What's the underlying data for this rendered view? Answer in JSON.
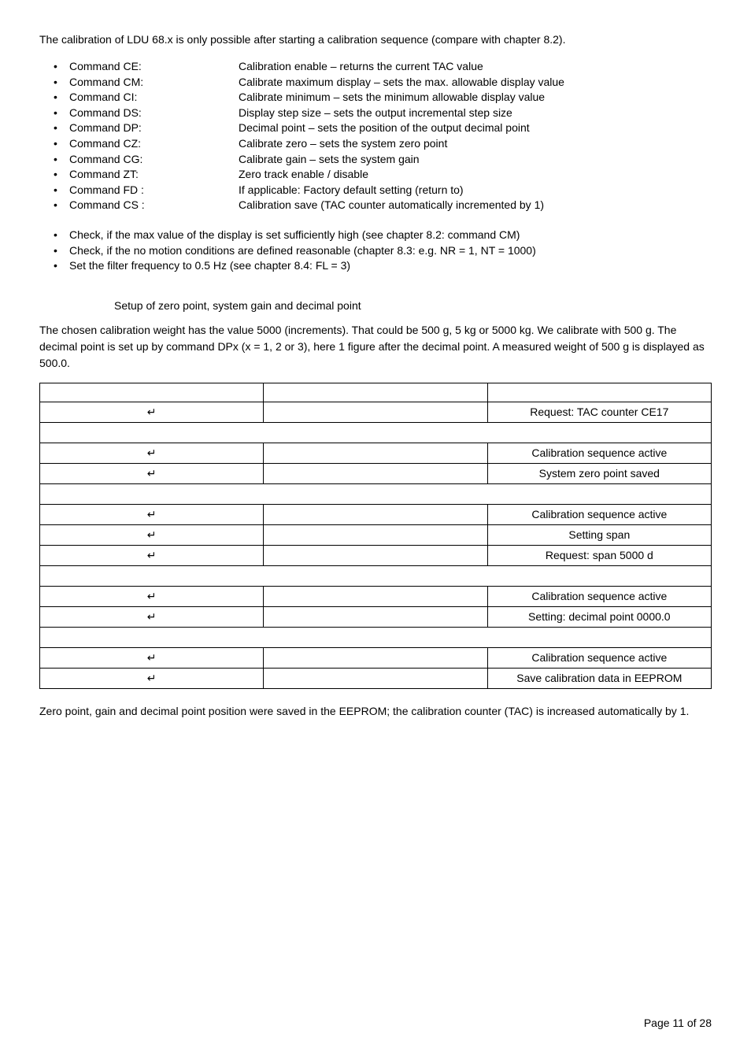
{
  "intro": "The calibration of LDU 68.x is only possible after starting a calibration sequence (compare with chapter 8.2).",
  "commands": [
    {
      "label": "Command CE:",
      "desc": "Calibration enable – returns the current TAC value"
    },
    {
      "label": "Command CM:",
      "desc": "Calibrate maximum display – sets the max. allowable display value"
    },
    {
      "label": "Command CI:",
      "desc": "Calibrate minimum – sets the minimum allowable display value"
    },
    {
      "label": "Command DS:",
      "desc": "Display step size – sets the output incremental step size"
    },
    {
      "label": "Command DP:",
      "desc": "Decimal point – sets the position of the output decimal point"
    },
    {
      "label": "Command CZ:",
      "desc": "Calibrate zero – sets the system zero point"
    },
    {
      "label": "Command CG:",
      "desc": "Calibrate gain – sets the system gain"
    },
    {
      "label": "Command ZT:",
      "desc": "Zero track enable / disable"
    },
    {
      "label": "Command FD :",
      "desc": "If applicable: Factory default setting (return to)"
    },
    {
      "label": "Command CS :",
      "desc": "Calibration save (TAC counter automatically incremented by 1)"
    }
  ],
  "checks": [
    "Check, if the max value of the display is set sufficiently high (see chapter 8.2: command CM)",
    "Check, if the no motion conditions are defined reasonable (chapter 8.3: e.g. NR = 1, NT = 1000)",
    "Set the filter frequency to 0.5 Hz (see chapter 8.4: FL = 3)"
  ],
  "section_title": "Setup of zero point, system gain and decimal point",
  "para": "The chosen calibration weight has the value 5000 (increments). That could be 500 g, 5 kg or 5000 kg. We calibrate with 500 g. The decimal point is set up by command DPx (x = 1, 2 or 3), here 1 figure after the decimal point. A measured weight of 500 g is displayed as 500.0.",
  "enter_symbol": "↵",
  "table_rows": [
    {
      "type": "header",
      "c1": "",
      "c2": "",
      "c3": ""
    },
    {
      "type": "data",
      "c1_enter": true,
      "c2": "",
      "c3": "Request: TAC counter CE17"
    },
    {
      "type": "span"
    },
    {
      "type": "data",
      "c1_enter": true,
      "c2": "",
      "c3": "Calibration sequence active"
    },
    {
      "type": "data",
      "c1_enter": true,
      "c2": "",
      "c3": "System zero point saved"
    },
    {
      "type": "span"
    },
    {
      "type": "data",
      "c1_enter": true,
      "c2": "",
      "c3": "Calibration sequence active"
    },
    {
      "type": "data",
      "c1_enter": true,
      "c2": "",
      "c3": "Setting span"
    },
    {
      "type": "data",
      "c1_enter": true,
      "c2": "",
      "c3": "Request: span 5000 d"
    },
    {
      "type": "span"
    },
    {
      "type": "data",
      "c1_enter": true,
      "c2": "",
      "c3": "Calibration sequence active"
    },
    {
      "type": "data",
      "c1_enter": true,
      "c2": "",
      "c3": "Setting: decimal point 0000.0"
    },
    {
      "type": "span"
    },
    {
      "type": "data",
      "c1_enter": true,
      "c2": "",
      "c3": "Calibration sequence active"
    },
    {
      "type": "data",
      "c1_enter": true,
      "c2": "",
      "c3": "Save calibration data in EEPROM"
    }
  ],
  "closing": "Zero point, gain and decimal point position were saved in the EEPROM;  the calibration counter (TAC) is increased automatically by 1.",
  "page_footer": "Page 11 of 28"
}
